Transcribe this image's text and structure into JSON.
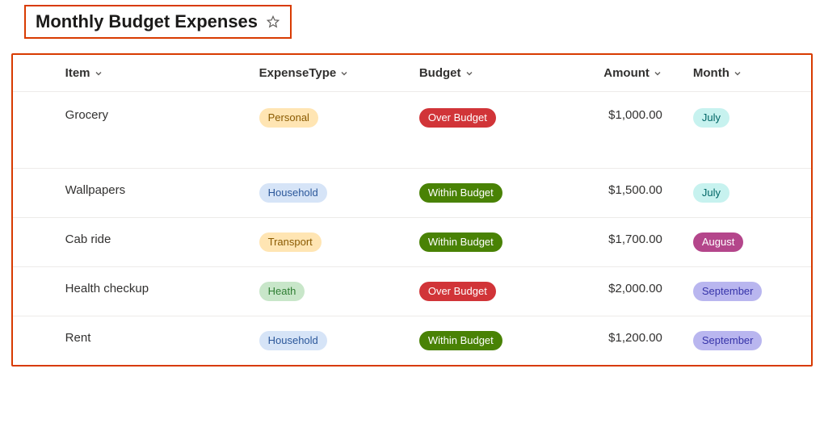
{
  "title": "Monthly Budget Expenses",
  "columns": {
    "item": "Item",
    "expenseType": "ExpenseType",
    "budget": "Budget",
    "amount": "Amount",
    "month": "Month"
  },
  "rows": [
    {
      "item": "Grocery",
      "expenseType": "Personal",
      "expenseTypeClass": "pill-personal",
      "budget": "Over Budget",
      "budgetClass": "pill-over",
      "amount": "$1,000.00",
      "month": "July",
      "monthClass": "pill-july",
      "tall": true
    },
    {
      "item": "Wallpapers",
      "expenseType": "Household",
      "expenseTypeClass": "pill-household",
      "budget": "Within Budget",
      "budgetClass": "pill-within",
      "amount": "$1,500.00",
      "month": "July",
      "monthClass": "pill-july"
    },
    {
      "item": "Cab ride",
      "expenseType": "Transport",
      "expenseTypeClass": "pill-transport",
      "budget": "Within Budget",
      "budgetClass": "pill-within",
      "amount": "$1,700.00",
      "month": "August",
      "monthClass": "pill-august"
    },
    {
      "item": "Health checkup",
      "expenseType": "Heath",
      "expenseTypeClass": "pill-heath",
      "budget": "Over Budget",
      "budgetClass": "pill-over",
      "amount": "$2,000.00",
      "month": "September",
      "monthClass": "pill-september"
    },
    {
      "item": "Rent",
      "expenseType": "Household",
      "expenseTypeClass": "pill-household",
      "budget": "Within Budget",
      "budgetClass": "pill-within",
      "amount": "$1,200.00",
      "month": "September",
      "monthClass": "pill-september"
    }
  ]
}
